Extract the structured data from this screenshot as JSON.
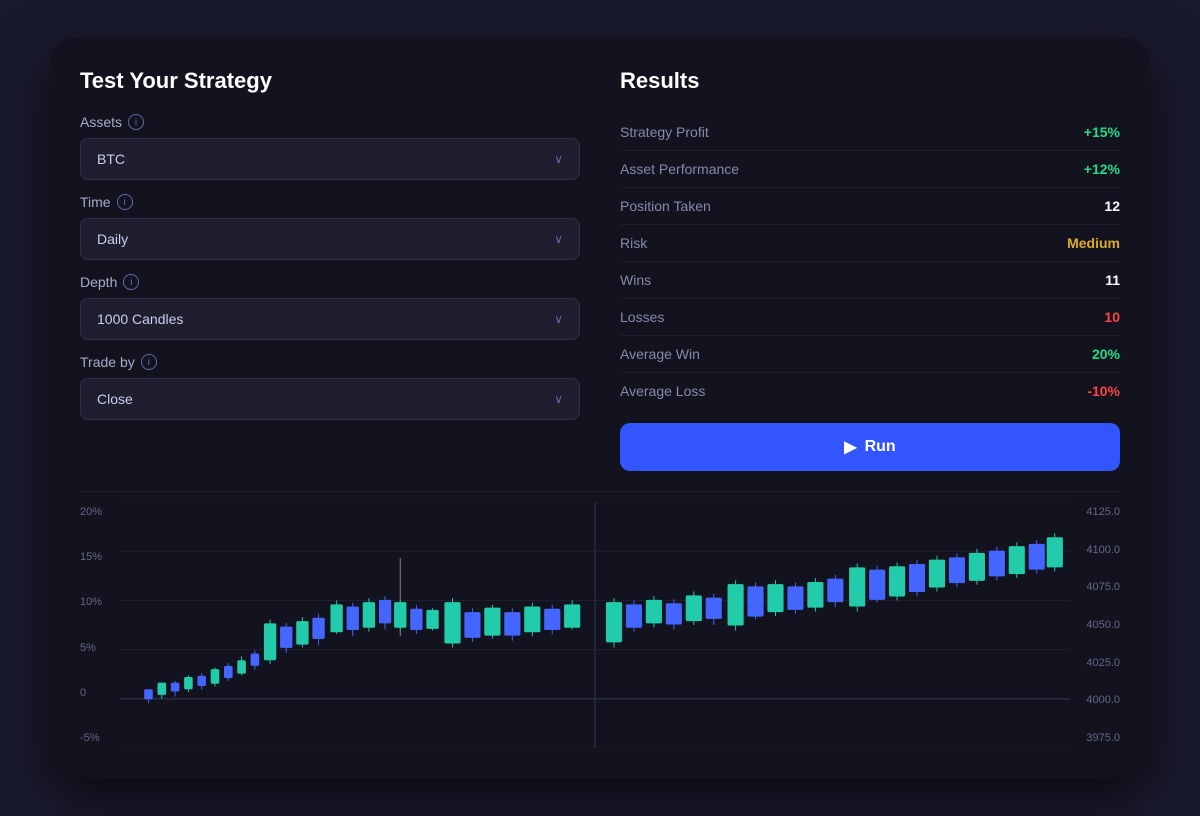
{
  "app": {
    "left_title": "Test Your Strategy",
    "right_title": "Results"
  },
  "left_panel": {
    "assets_label": "Assets",
    "assets_value": "BTC",
    "time_label": "Time",
    "time_value": "Daily",
    "depth_label": "Depth",
    "depth_value": "1000 Candles",
    "trade_by_label": "Trade by",
    "trade_by_value": "Close"
  },
  "results": [
    {
      "label": "Strategy Profit",
      "value": "+15%",
      "color": "val-green"
    },
    {
      "label": "Asset Performance",
      "value": "+12%",
      "color": "val-green"
    },
    {
      "label": "Position Taken",
      "value": "12",
      "color": "val-white"
    },
    {
      "label": "Risk",
      "value": "Medium",
      "color": "val-yellow"
    },
    {
      "label": "Wins",
      "value": "11",
      "color": "val-white"
    },
    {
      "label": "Losses",
      "value": "10",
      "color": "val-red"
    },
    {
      "label": "Average Win",
      "value": "20%",
      "color": "val-green"
    },
    {
      "label": "Average Loss",
      "value": "-10%",
      "color": "val-red"
    }
  ],
  "run_button": {
    "label": "Run"
  },
  "chart": {
    "y_axis_left": [
      "20%",
      "15%",
      "10%",
      "5%",
      "0",
      "-5%"
    ],
    "y_axis_right": [
      "4125.0",
      "4100.0",
      "4075.0",
      "4050.0",
      "4025.0",
      "4000.0",
      "3975.0"
    ]
  },
  "icons": {
    "info": "i",
    "chevron_down": "∨",
    "play": "▶"
  }
}
